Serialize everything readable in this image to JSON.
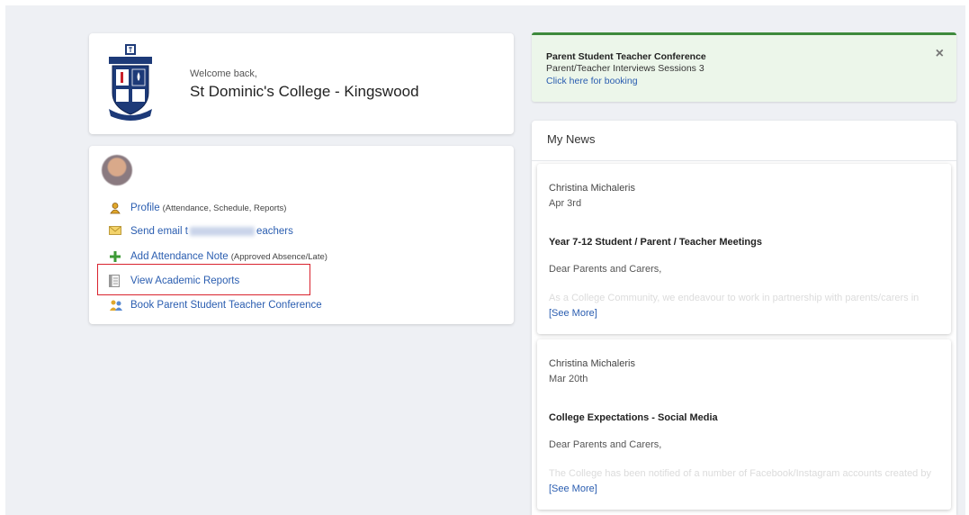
{
  "welcome": {
    "greeting": "Welcome back,",
    "school_name": "St Dominic's College - Kingswood",
    "crest_text_top": "ST DOMINIC'S COLLEGE",
    "crest_text_bottom": "ACTA NON VERBA"
  },
  "links": [
    {
      "icon": "profile-icon",
      "label": "Profile",
      "sub": "(Attendance, Schedule, Reports)"
    },
    {
      "icon": "email-icon",
      "label_before": "Send email t",
      "label_after": "eachers"
    },
    {
      "icon": "plus-icon",
      "label": "Add Attendance Note",
      "sub": "(Approved Absence/Late)"
    },
    {
      "icon": "report-icon",
      "label": "View Academic Reports"
    },
    {
      "icon": "conference-icon",
      "label": "Book Parent Student Teacher Conference"
    }
  ],
  "notification": {
    "title": "Parent Student Teacher Conference",
    "line": "Parent/Teacher Interviews Sessions 3",
    "link": "Click here for booking",
    "close": "×"
  },
  "news": {
    "header": "My News",
    "items": [
      {
        "author": "Christina Michaleris",
        "date": "Apr 3rd",
        "headline": "Year 7-12 Student / Parent / Teacher Meetings",
        "greeting": "Dear Parents and Carers,",
        "preview": "As a College Community, we endeavour to work in partnership with parents/carers in",
        "see_more": "[See More]"
      },
      {
        "author": "Christina Michaleris",
        "date": "Mar 20th",
        "headline": "College Expectations - Social Media",
        "greeting": "Dear Parents and Carers,",
        "preview": "The College has been notified of a number of Facebook/Instagram accounts created by",
        "see_more": "[See More]"
      }
    ]
  },
  "colors": {
    "link": "#2a5db0",
    "highlight": "#d9232e",
    "notif_accent": "#3e8a3c",
    "notif_bg": "#ecf6ea",
    "page_bg": "#eef0f4"
  }
}
